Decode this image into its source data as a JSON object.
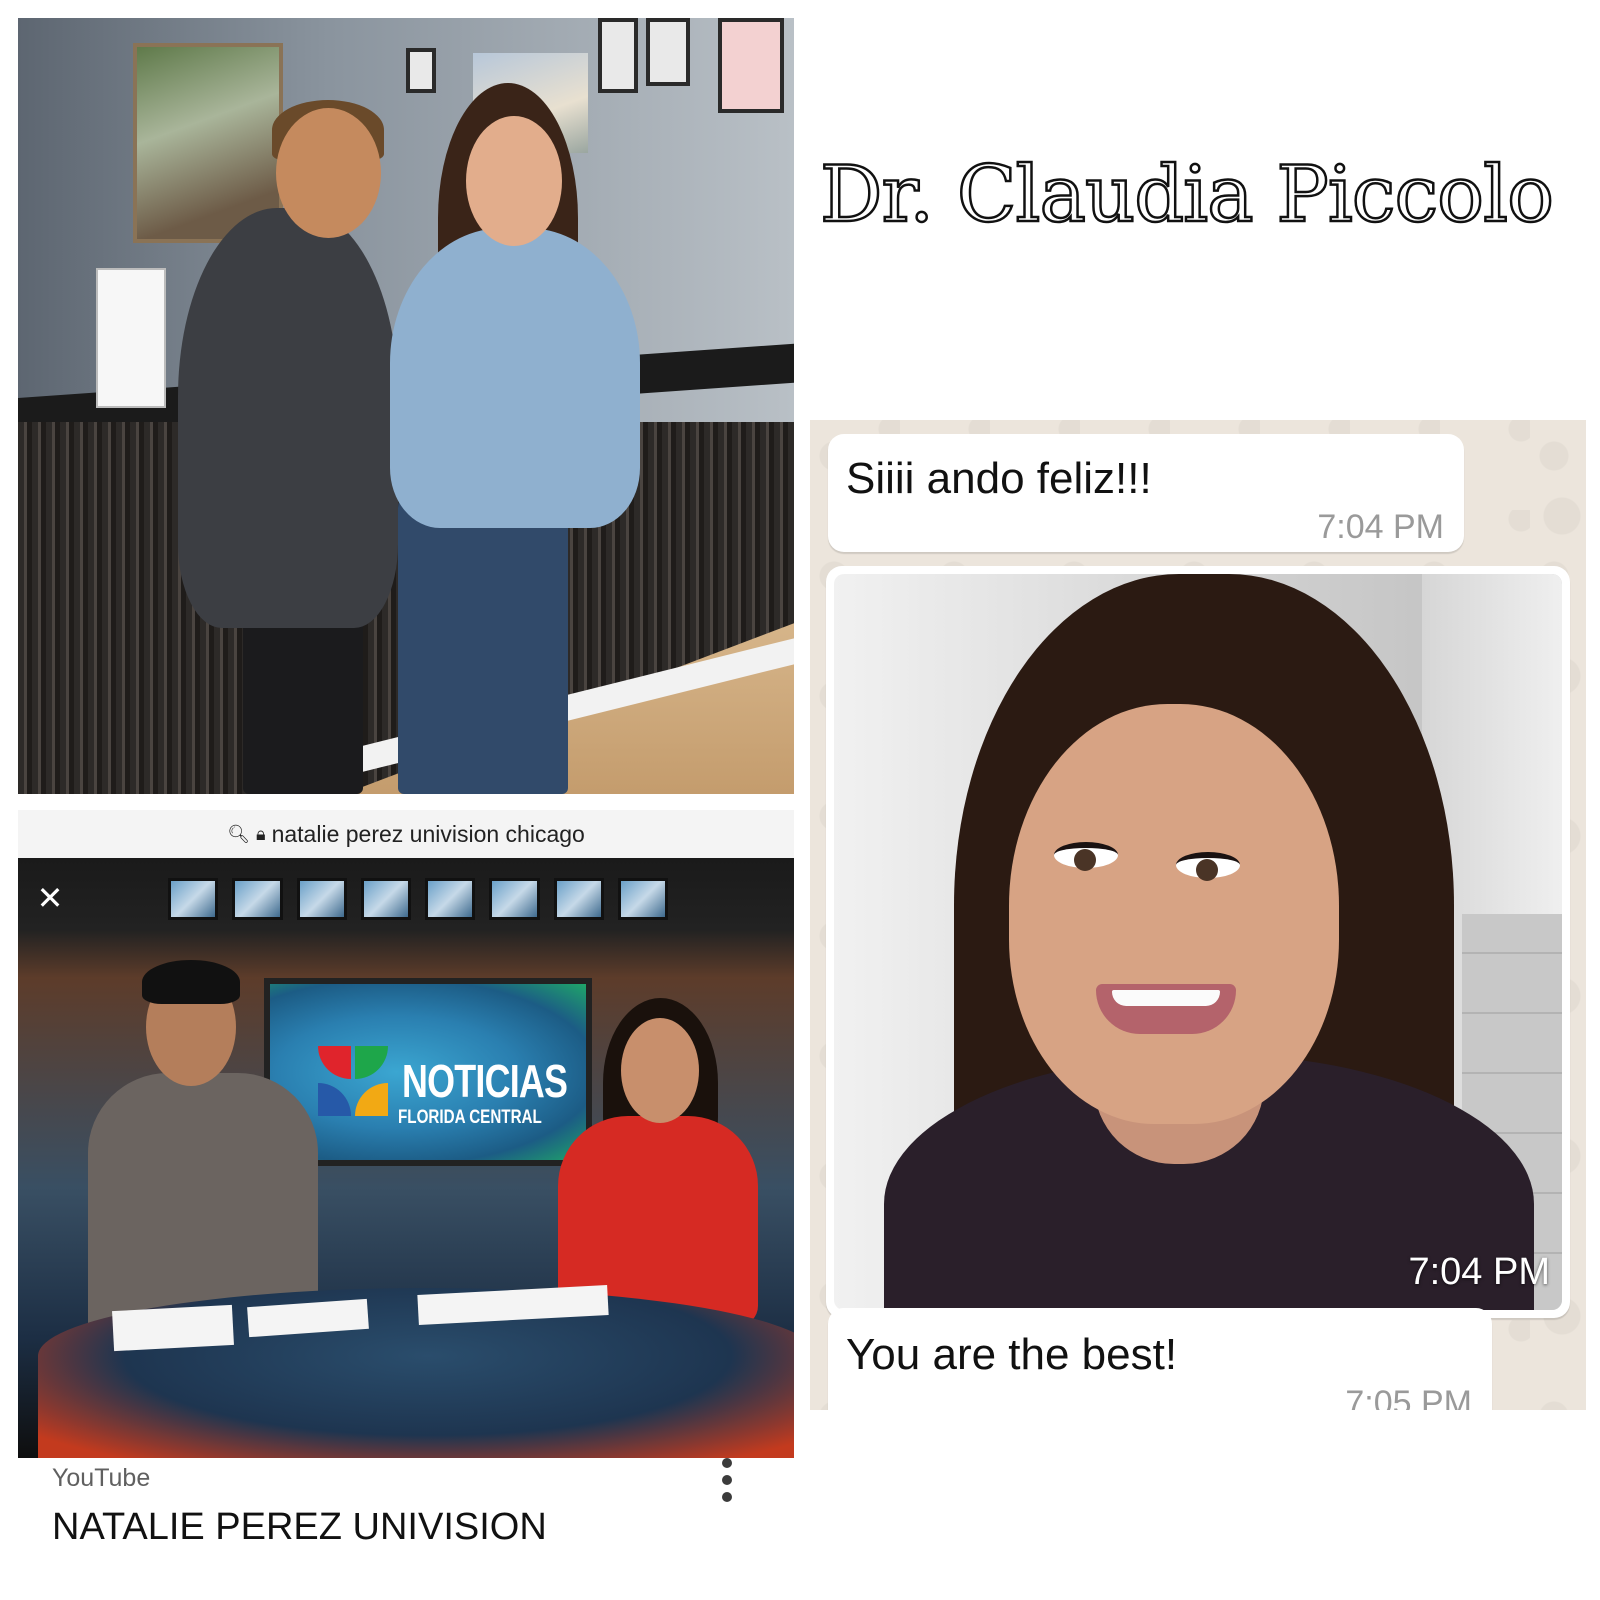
{
  "heading": {
    "name": "Dr. Claudia Piccolo"
  },
  "youtube": {
    "url_query": "natalie perez univision chicago",
    "search_icon": "search-icon",
    "lock_icon": "lock-icon",
    "close_icon": "close-icon",
    "video": {
      "screen_title": "NOTICIAS",
      "screen_subtitle": "FLORIDA CENTRAL",
      "logo_colors": [
        "#e0242c",
        "#1ea64a",
        "#2659a8",
        "#f2a914"
      ]
    },
    "source": "YouTube",
    "title": "NATALIE PEREZ UNIVISION",
    "menu_icon": "more-vertical-icon"
  },
  "chat": {
    "messages": [
      {
        "text": "Siiii ando feliz!!!",
        "time": "7:04 PM"
      },
      {
        "image_time": "7:04 PM"
      },
      {
        "text": "You are the best!",
        "time": "7:05 PM"
      }
    ],
    "bubble_color": "#ffffff",
    "background_color": "#ece5dc"
  }
}
